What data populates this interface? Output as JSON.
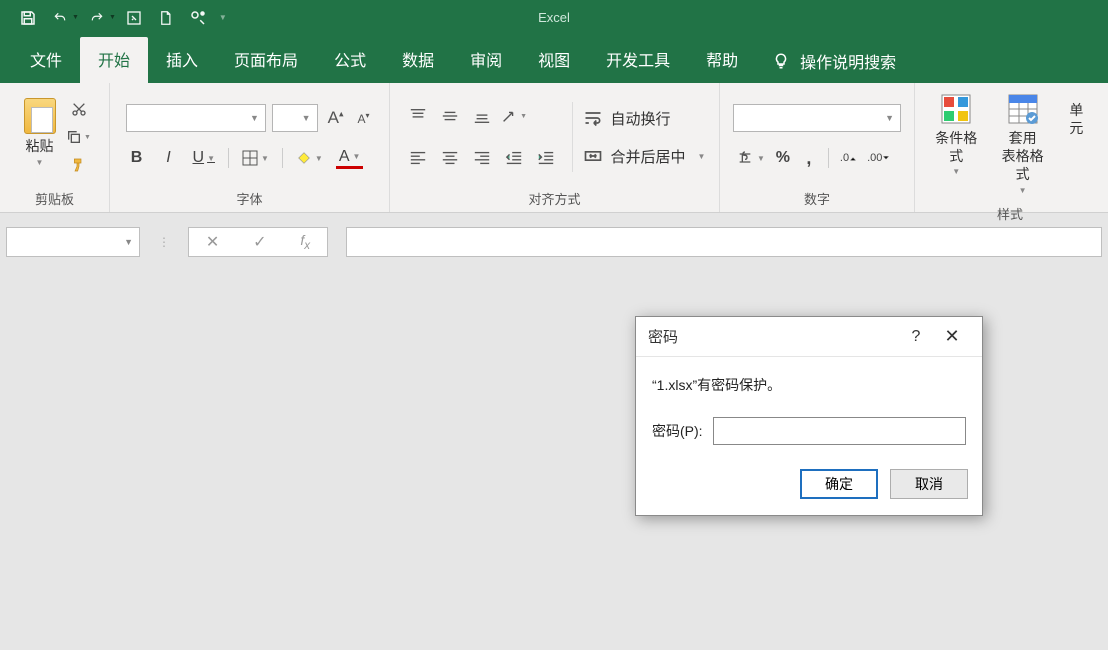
{
  "app_title": "Excel",
  "qat": {
    "save": "save-icon",
    "undo": "undo-icon",
    "redo": "redo-icon",
    "touch": "touch-icon",
    "new": "new-icon",
    "share": "share-icon"
  },
  "tabs": {
    "file": "文件",
    "home": "开始",
    "insert": "插入",
    "page_layout": "页面布局",
    "formulas": "公式",
    "data": "数据",
    "review": "审阅",
    "view": "视图",
    "developer": "开发工具",
    "help": "帮助",
    "tell_me": "操作说明搜索"
  },
  "ribbon": {
    "clipboard": {
      "paste": "粘贴",
      "label": "剪贴板"
    },
    "font": {
      "label": "字体",
      "bold": "B",
      "italic": "I",
      "underline": "U"
    },
    "alignment": {
      "label": "对齐方式",
      "wrap": "自动换行",
      "merge": "合并后居中"
    },
    "number": {
      "label": "数字",
      "percent": "%"
    },
    "styles": {
      "label": "样式",
      "cond": "条件格式",
      "table": "套用\n表格格式",
      "cell": "单元"
    }
  },
  "dialog": {
    "title": "密码",
    "message": "“1.xlsx”有密码保护。",
    "field_label": "密码(P):",
    "ok": "确定",
    "cancel": "取消"
  }
}
